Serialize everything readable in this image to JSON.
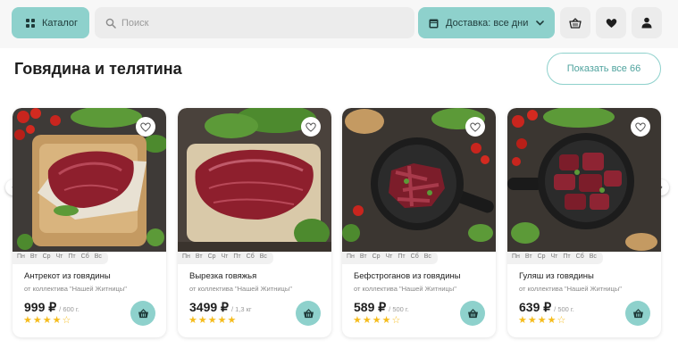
{
  "header": {
    "catalog_label": "Каталог",
    "search_placeholder": "Поиск",
    "delivery_label": "Доставка: все дни"
  },
  "section": {
    "title": "Говядина и телятина",
    "show_all_label": "Показать все 66"
  },
  "days": [
    "Пн",
    "Вт",
    "Ср",
    "Чт",
    "Пт",
    "Сб",
    "Вс"
  ],
  "products": [
    {
      "title": "Антрекот из говядины",
      "maker": "от коллектива \"Нашей Житницы\"",
      "price": "999 ₽",
      "unit": "/ 600 г.",
      "rating": 4
    },
    {
      "title": "Вырезка говяжья",
      "maker": "от коллектива \"Нашей Житницы\"",
      "price": "3499 ₽",
      "unit": "/ 1,3 кг",
      "rating": 5
    },
    {
      "title": "Бефстроганов из говядины",
      "maker": "от коллектива \"Нашей Житницы\"",
      "price": "589 ₽",
      "unit": "/ 500 г.",
      "rating": 4
    },
    {
      "title": "Гуляш из говядины",
      "maker": "от коллектива \"Нашей Житницы\"",
      "price": "639 ₽",
      "unit": "/ 500 г.",
      "rating": 4
    }
  ],
  "colors": {
    "accent": "#8ed1cc",
    "star": "#f5bc1d"
  }
}
